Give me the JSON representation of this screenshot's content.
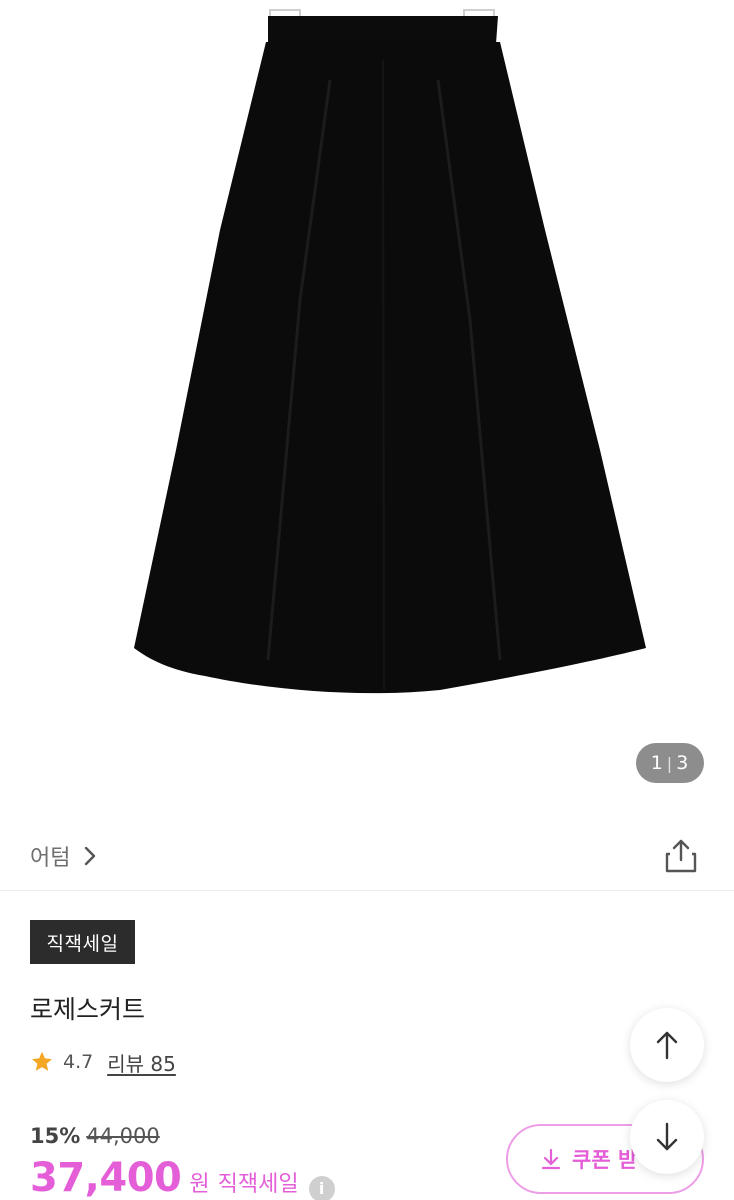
{
  "gallery": {
    "current_page": "1",
    "separator": "|",
    "total_pages": "3",
    "image_icon": "product-photo-black-a-line-skirt"
  },
  "brand": {
    "name": "어텀",
    "icon": "chevron-right-icon"
  },
  "share": {
    "icon": "share-icon"
  },
  "badge": {
    "label": "직잭세일"
  },
  "product": {
    "name": "로제스커트"
  },
  "rating": {
    "score": "4.7",
    "review_label": "리뷰 85",
    "icon": "star-icon",
    "star_color": "#f5a623"
  },
  "pricing": {
    "discount_rate": "15%",
    "original_price": "44,000",
    "sale_price": "37,400",
    "currency": "원",
    "sale_label": "직잭세일",
    "info_icon_label": "i",
    "accent_color": "#e45ed8"
  },
  "coupon": {
    "label": "쿠폰 받",
    "icon": "download-icon"
  },
  "fab": {
    "up_icon": "arrow-up-icon",
    "down_icon": "arrow-down-icon"
  }
}
